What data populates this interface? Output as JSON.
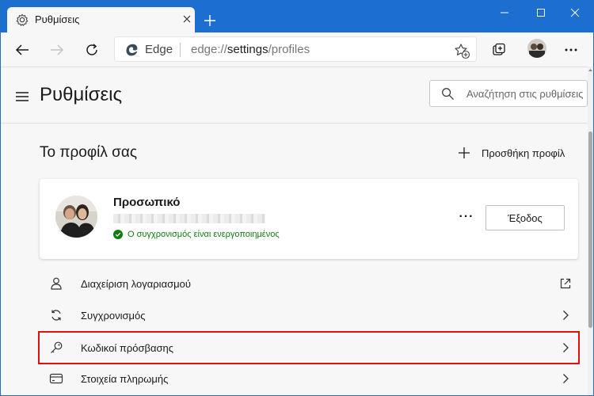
{
  "tab": {
    "title": "Ρυθμίσεις"
  },
  "address_bar": {
    "site_name": "Edge",
    "url_scheme": "edge://",
    "url_path": "settings",
    "url_rest": "/profiles"
  },
  "header": {
    "title": "Ρυθμίσεις",
    "search_placeholder": "Αναζήτηση στις ρυθμίσεις"
  },
  "profiles": {
    "section_title": "Το προφίλ σας",
    "add_profile_label": "Προσθήκη προφίλ",
    "card": {
      "name": "Προσωπικό",
      "sync_status": "Ο συγχρονισμός είναι ενεργοποιημένος",
      "more_label": "···",
      "signout_label": "Έξοδος"
    },
    "items": [
      {
        "label": "Διαχείριση λογαριασμού",
        "icon": "person-icon",
        "end_icon": "external-link-icon"
      },
      {
        "label": "Συγχρονισμός",
        "icon": "sync-icon",
        "end_icon": "chevron-right-icon"
      },
      {
        "label": "Κωδικοί πρόσβασης",
        "icon": "key-icon",
        "end_icon": "chevron-right-icon"
      },
      {
        "label": "Στοιχεία πληρωμής",
        "icon": "credit-card-icon",
        "end_icon": "chevron-right-icon"
      }
    ]
  },
  "colors": {
    "titlebar": "#1c6fd1",
    "highlight": "#e01010",
    "sync_green": "#107c10"
  }
}
